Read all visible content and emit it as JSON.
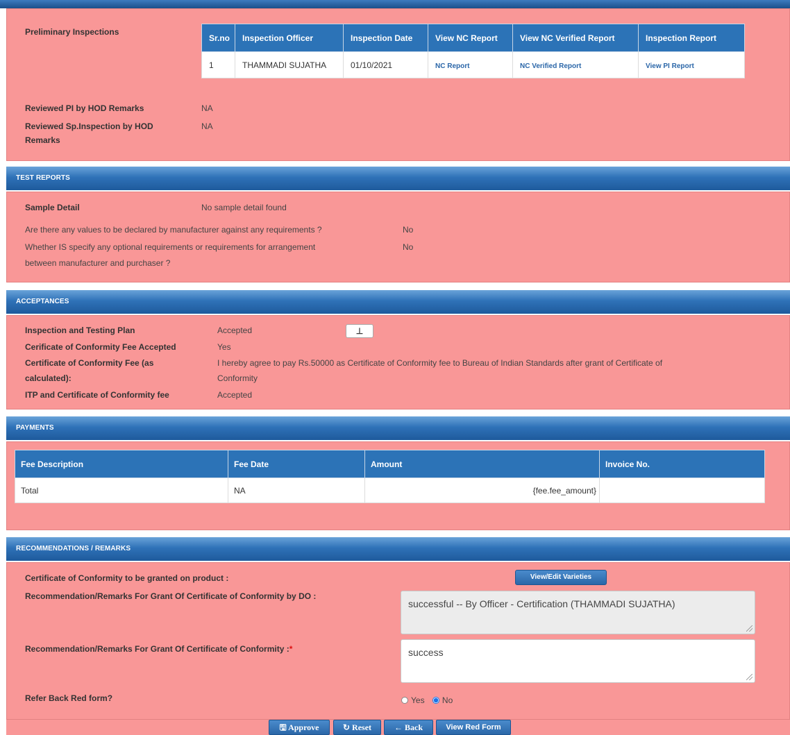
{
  "preliminary": {
    "label": "Preliminary Inspections",
    "columns": [
      "Sr.no",
      "Inspection Officer",
      "Inspection Date",
      "View NC Report",
      "View NC Verified Report",
      "Inspection Report"
    ],
    "row": {
      "srno": "1",
      "officer": "THAMMADI SUJATHA",
      "date": "01/10/2021",
      "nc_report": "NC Report",
      "nc_verified": "NC Verified Report",
      "pi_report": "View PI Report"
    },
    "hod_pi_label": "Reviewed PI by HOD Remarks",
    "hod_pi_value": "NA",
    "hod_sp_label_1": "Reviewed Sp.Inspection by HOD",
    "hod_sp_label_2": "Remarks",
    "hod_sp_value": "NA"
  },
  "test_reports": {
    "title": "TEST REPORTS",
    "sample_label": "Sample Detail",
    "sample_value": "No sample detail found",
    "q1": "Are there any values to be declared by manufacturer against any requirements ?",
    "q1_value": "No",
    "q2_line1": "Whether IS specify any optional requirements or requirements for arrangement",
    "q2_line2": "between manufacturer and purchaser ?",
    "q2_value": "No"
  },
  "acceptances": {
    "title": "ACCEPTANCES",
    "itp_label": "Inspection and Testing Plan",
    "itp_value": "Accepted",
    "fee_accepted_label": "Cerificate of Conformity Fee Accepted",
    "fee_accepted_value": "Yes",
    "fee_calc_label_1": "Certificate of Conformity Fee (as",
    "fee_calc_label_2": "calculated):",
    "fee_calc_value_1": "I hereby agree to pay Rs.50000 as Certificate of Conformity fee to Bureau of Indian Standards after grant of Certificate of",
    "fee_calc_value_2": "Conformity",
    "itp_fee_label": "ITP and Certificate of Conformity fee",
    "itp_fee_value": "Accepted"
  },
  "payments": {
    "title": "PAYMENTS",
    "columns": [
      "Fee Description",
      "Fee Date",
      "Amount",
      "Invoice No."
    ],
    "row": {
      "desc": "Total",
      "date": "NA",
      "amount": "{fee.fee_amount}",
      "invoice": ""
    }
  },
  "recommendations": {
    "title": "RECOMMENDATIONS / REMARKS",
    "coc_label": "Certificate of Conformity to be granted on product :",
    "view_edit_btn": "View/Edit Varieties",
    "do_label": "Recommendation/Remarks For Grant Of Certificate of Conformity by DO :",
    "do_value": "successful -- By Officer - Certification (THAMMADI  SUJATHA)",
    "grant_label": "Recommendation/Remarks For Grant Of Certificate of Conformity :",
    "required_mark": "*",
    "grant_value": "success",
    "refer_label": "Refer Back Red form?",
    "yes_label": "Yes",
    "no_label": "No",
    "selected": "No"
  },
  "actions": {
    "approve": "Approve",
    "reset": "Reset",
    "back": "Back",
    "view_red_form": "View Red Form"
  },
  "colors": {
    "panel": "#f99797",
    "header_blue": "#2c73b7",
    "link": "#2a66a8"
  }
}
